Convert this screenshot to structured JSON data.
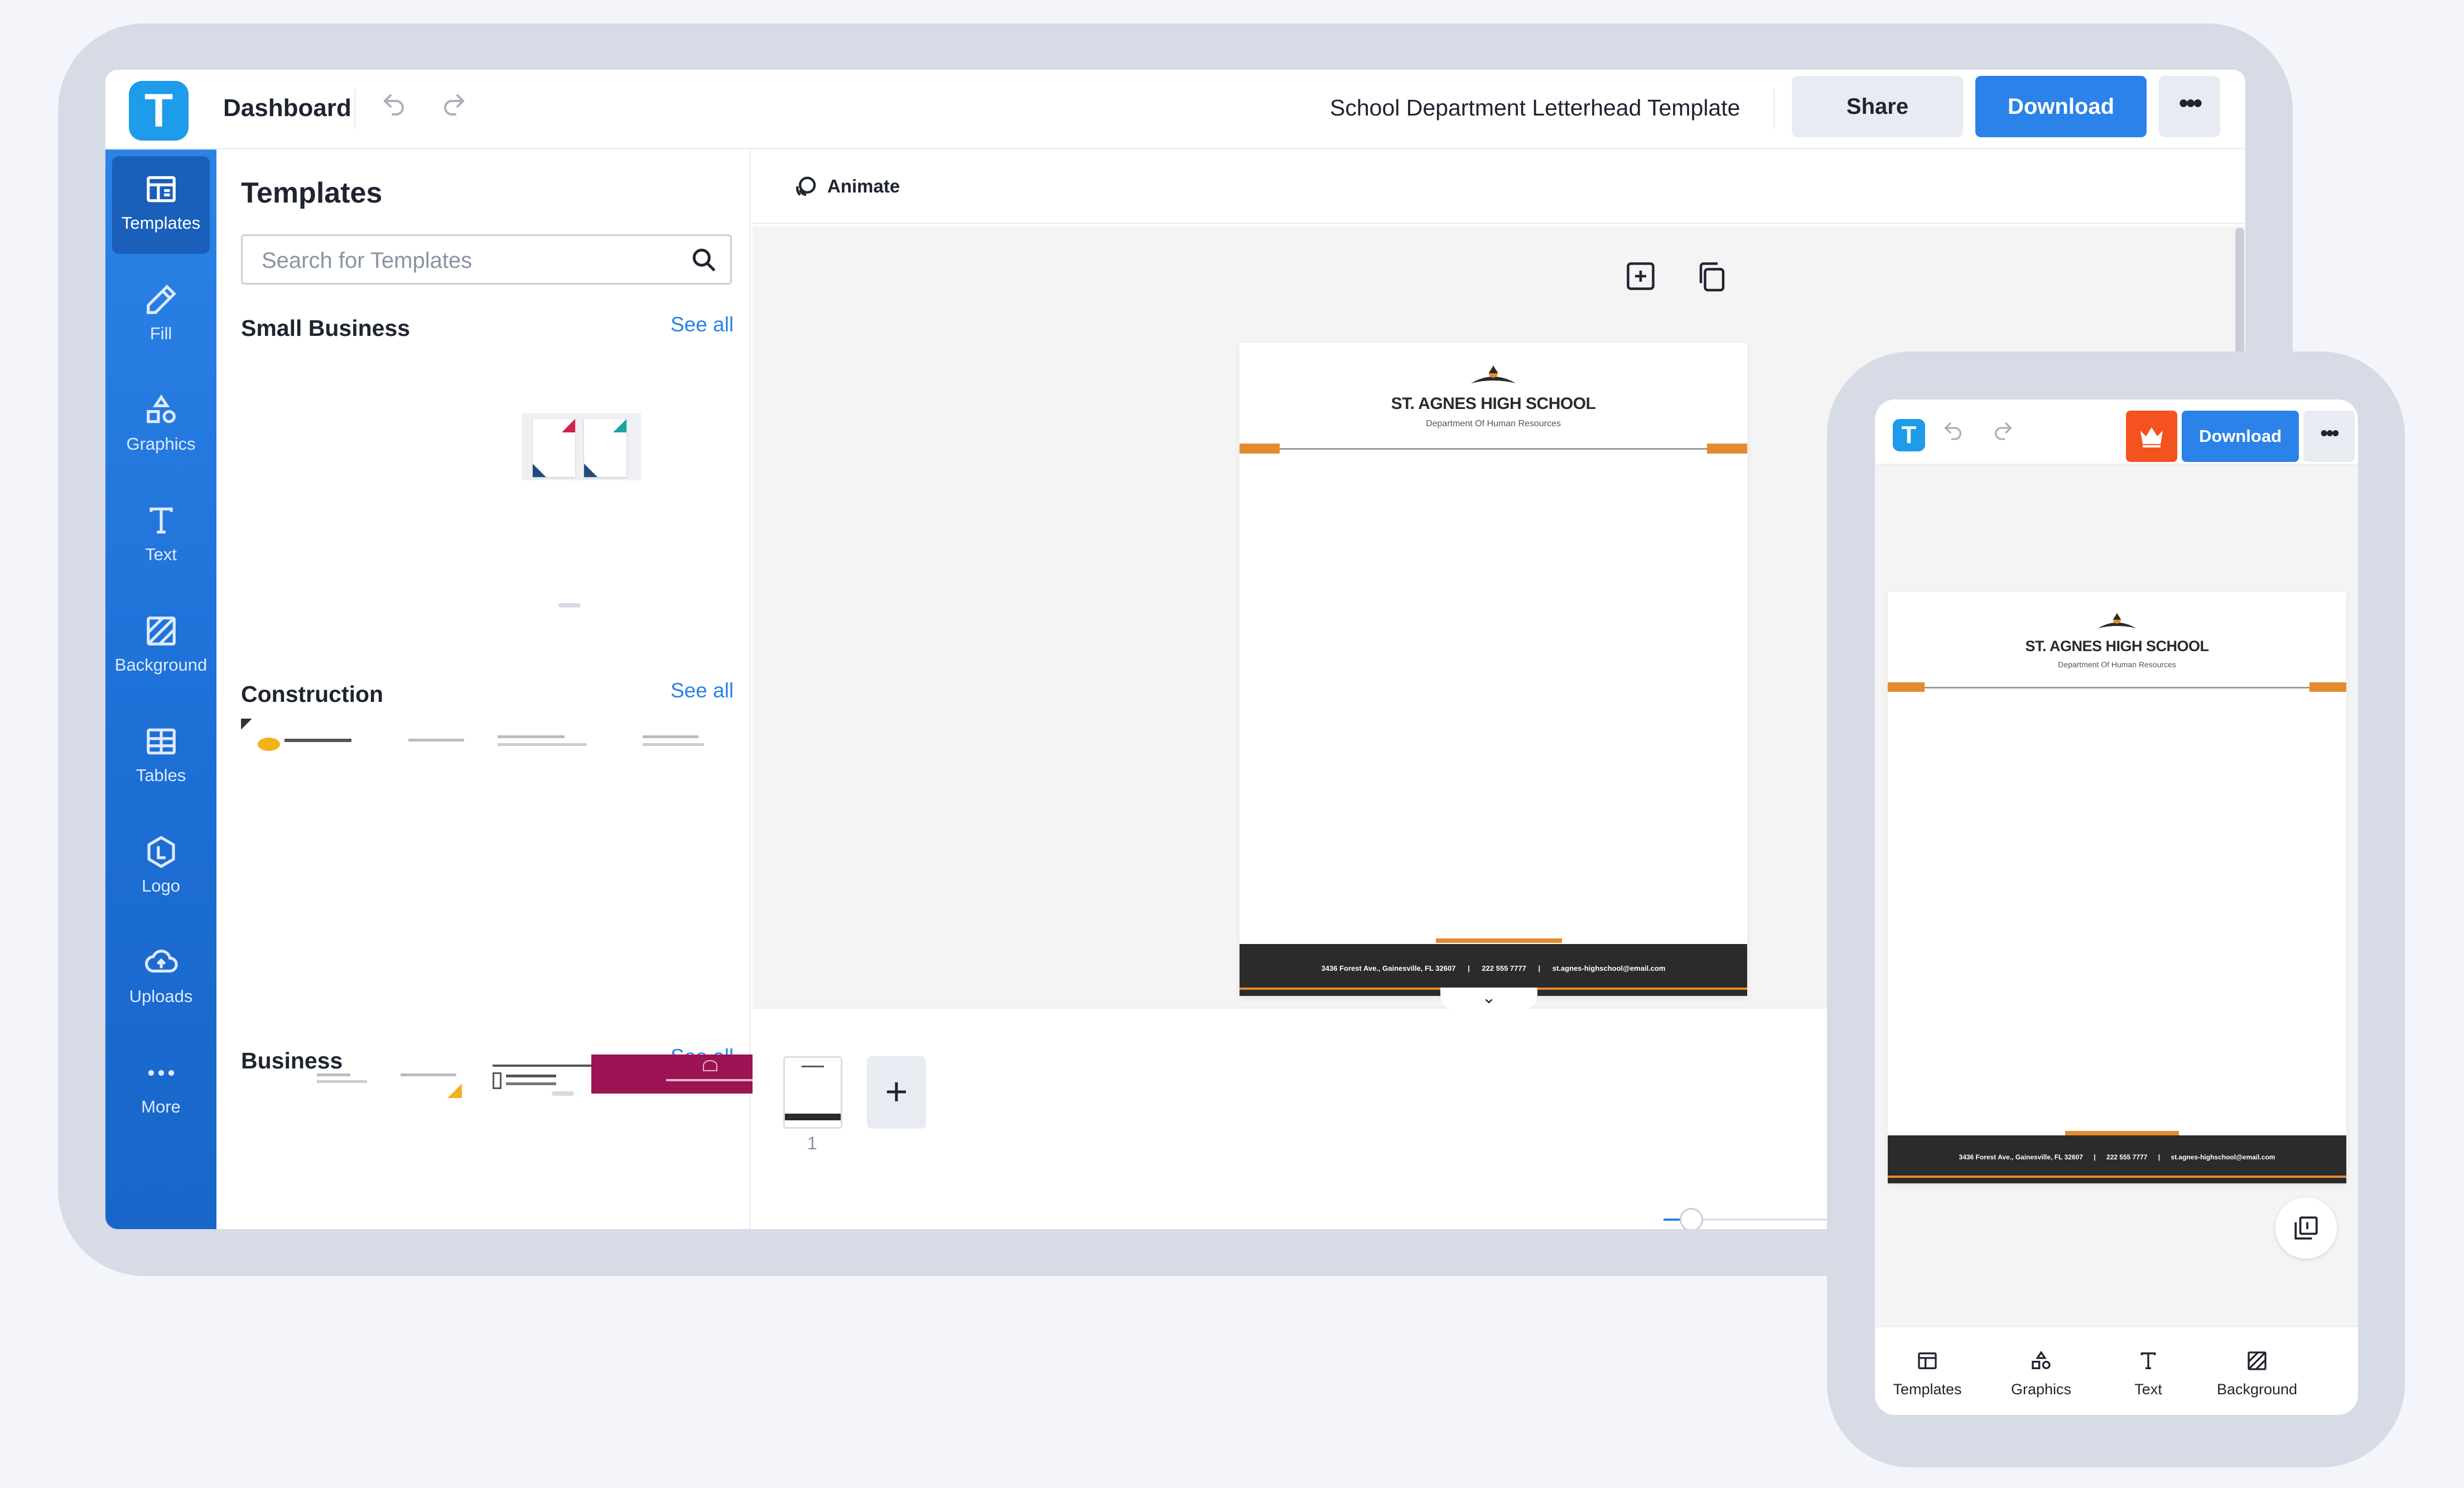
{
  "app": {
    "logo_letter": "T",
    "dashboard_label": "Dashboard",
    "document_title": "School Department Letterhead Template",
    "share_label": "Share",
    "download_label": "Download",
    "more_label": "•••"
  },
  "sidebar": {
    "items": [
      {
        "label": "Templates",
        "icon": "templates-icon"
      },
      {
        "label": "Fill",
        "icon": "pencil-icon"
      },
      {
        "label": "Graphics",
        "icon": "shapes-icon"
      },
      {
        "label": "Text",
        "icon": "text-icon"
      },
      {
        "label": "Background",
        "icon": "hatch-icon"
      },
      {
        "label": "Tables",
        "icon": "table-icon"
      },
      {
        "label": "Logo",
        "icon": "logo-icon"
      },
      {
        "label": "Uploads",
        "icon": "cloud-upload-icon"
      },
      {
        "label": "More",
        "icon": "dots-icon"
      }
    ],
    "active": "Templates"
  },
  "templates_panel": {
    "title": "Templates",
    "search_placeholder": "Search for Templates",
    "sections": [
      {
        "title": "Small Business",
        "see_all": "See all"
      },
      {
        "title": "Construction",
        "see_all": "See all"
      },
      {
        "title": "Business",
        "see_all": "See all"
      }
    ]
  },
  "editor": {
    "animate_label": "Animate",
    "page_number": "1",
    "add_page_label": "+"
  },
  "letterhead": {
    "school_name": "ST. AGNES HIGH SCHOOL",
    "department": "Department Of Human Resources",
    "address": "3436 Forest Ave., Gainesville, FL 32607",
    "phone": "222 555 7777",
    "email": "st.agnes-highschool@email.com",
    "separator": "|",
    "accent_color": "#e58b2f",
    "footer_color": "#2b2b2b"
  },
  "phone": {
    "logo_letter": "T",
    "download_label": "Download",
    "more_label": "•••",
    "nav": [
      {
        "label": "Templates",
        "icon": "templates-icon"
      },
      {
        "label": "Graphics",
        "icon": "shapes-icon"
      },
      {
        "label": "Text",
        "icon": "text-icon"
      },
      {
        "label": "Background",
        "icon": "hatch-icon"
      }
    ]
  },
  "colors": {
    "brand_blue": "#2b82e8",
    "sidebar_blue": "#1d6fd6",
    "premium_orange": "#f4521e"
  }
}
